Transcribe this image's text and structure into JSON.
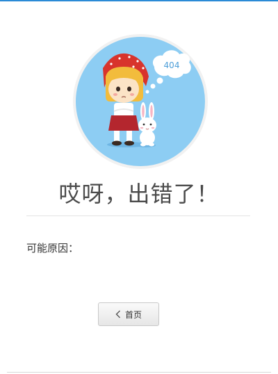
{
  "page": {
    "accent_color": "#2a8ad6",
    "title": "哎呀，出错了！",
    "reasons_label": "可能原因：",
    "error_code": "404"
  },
  "navigation": {
    "home_label": "首页",
    "home_icon": "chevron-left-icon"
  },
  "illustration": {
    "subject": "girl-and-rabbit-illustration",
    "background_color": "#8dcdf3"
  }
}
